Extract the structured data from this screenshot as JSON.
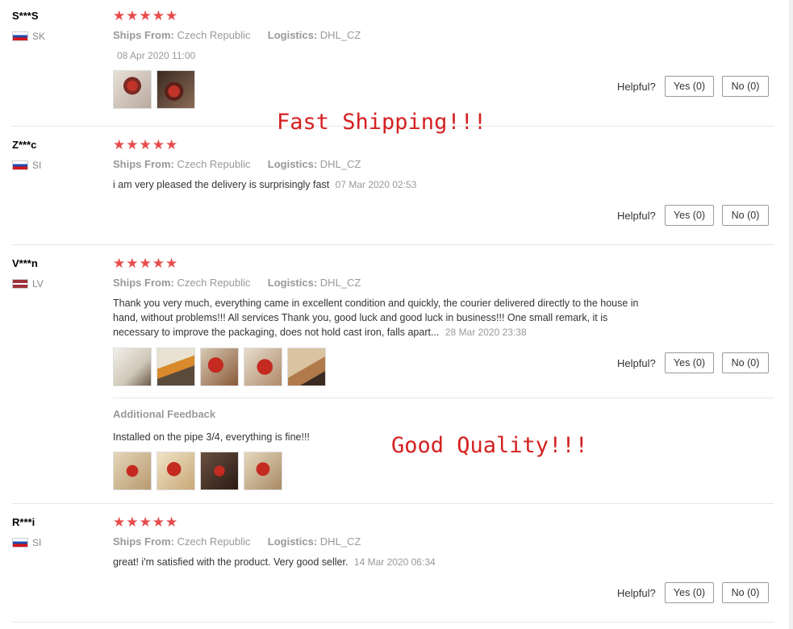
{
  "labels": {
    "ships_from": "Ships From:",
    "logistics": "Logistics:",
    "helpful": "Helpful?",
    "yes": "Yes (0)",
    "no": "No (0)",
    "additional_feedback": "Additional Feedback",
    "stars": "★★★★★"
  },
  "overlays": {
    "fast_shipping": "Fast Shipping!!!",
    "good_quality": "Good Quality!!!"
  },
  "reviews": [
    {
      "user": "S***S",
      "country": "SK",
      "rating": 5,
      "ships_from": "Czech Republic",
      "logistics": "DHL_CZ",
      "date": "08 Apr 2020 11:00",
      "photos": [
        "photo-1",
        "photo-2"
      ]
    },
    {
      "user": "Z***c",
      "country": "SI",
      "rating": 5,
      "ships_from": "Czech Republic",
      "logistics": "DHL_CZ",
      "text": "i am very pleased the delivery is surprisingly fast",
      "date": "07 Mar 2020 02:53"
    },
    {
      "user": "V***n",
      "country": "LV",
      "rating": 5,
      "ships_from": "Czech Republic",
      "logistics": "DHL_CZ",
      "text_lines": [
        "Thank you very much, everything came in excellent condition and quickly, the courier delivered directly to the house in",
        "hand, without problems!!! All services Thank you, good luck and good luck in business!!! One small remark, it is",
        "necessary to improve the packaging, does not hold cast iron, falls apart..."
      ],
      "date": "28 Mar 2020 23:38",
      "photos": [
        "photo-1",
        "photo-2",
        "photo-3",
        "photo-4",
        "photo-5"
      ],
      "additional_text": "Installed on the pipe 3/4, everything is fine!!!",
      "additional_photos": [
        "photo-1",
        "photo-2",
        "photo-3",
        "photo-4"
      ]
    },
    {
      "user": "R***i",
      "country": "SI",
      "rating": 5,
      "ships_from": "Czech Republic",
      "logistics": "DHL_CZ",
      "text": "great! i'm satisfied with the product. Very good seller.",
      "date": "14 Mar 2020 06:34"
    }
  ],
  "colors": {
    "star": "#e84b4b",
    "overlay_text": "#d42020"
  }
}
